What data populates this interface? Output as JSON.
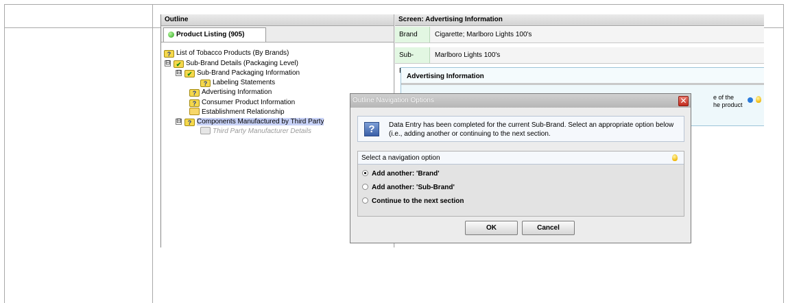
{
  "outline": {
    "header": "Outline",
    "tab_label": "Product Listing (905)",
    "tree": [
      {
        "label": "List of Tobacco Products (By Brands)",
        "icon": "question-folder-icon"
      },
      {
        "label": "Sub-Brand Details (Packaging Level)",
        "icon": "check-folder-icon",
        "expander": "⊟"
      },
      {
        "label": "Sub-Brand Packaging Information",
        "icon": "check-folder-icon",
        "expander": "⊟"
      },
      {
        "label": "Labeling Statements",
        "icon": "question-icon"
      },
      {
        "label": "Advertising Information",
        "icon": "question-icon"
      },
      {
        "label": "Consumer Product Information",
        "icon": "question-icon"
      },
      {
        "label": "Establishment Relationship",
        "icon": "folder-icon"
      },
      {
        "label": "Components Manufactured by Third Party",
        "icon": "question-icon",
        "expander": "⊟",
        "selected": true
      },
      {
        "label": "Third Party Manufacturer Details",
        "icon": "gray-folder-icon",
        "disabled": true
      }
    ]
  },
  "screen": {
    "header": "Screen: Advertising Information",
    "fields": [
      {
        "label": "Brand",
        "value": "Cigarette; Marlboro Lights 100's"
      },
      {
        "label": "Sub-Brand",
        "value": "Marlboro Lights 100's"
      }
    ],
    "section_title": "Advertising Information",
    "partial_text_1": "e of the",
    "partial_text_2": "he product"
  },
  "dialog": {
    "title": "Outline Navigation Options",
    "close_glyph": "✕",
    "message": "Data Entry has been completed for the current Sub-Brand. Select an appropriate option below (i.e., adding another or continuing to the next section.",
    "nav_header": "Select a navigation option",
    "options": [
      {
        "label": "Add another: 'Brand'",
        "selected": true
      },
      {
        "label": "Add another: 'Sub-Brand'",
        "selected": false
      },
      {
        "label": "Continue to the next section",
        "selected": false
      }
    ],
    "ok_label": "OK",
    "cancel_label": "Cancel"
  },
  "colors": {
    "tree_selection": "#c8d2f7",
    "label_cell": "#e2f7e2",
    "close_button": "#c12c1e",
    "status_green": "#29a71a"
  }
}
